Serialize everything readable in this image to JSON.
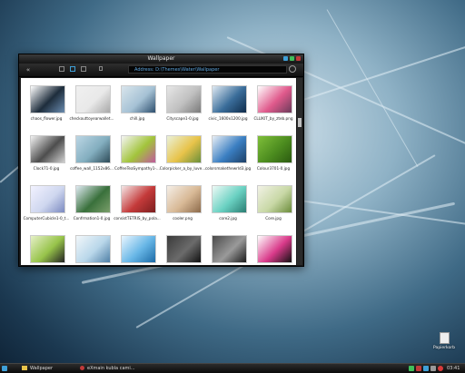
{
  "window": {
    "title": "Wallpaper",
    "address": "Address: D:\\Themes\\Water\\Wallpaper"
  },
  "toolbar": {
    "back_label": "«",
    "views": [
      "list",
      "icons",
      "details"
    ],
    "settings_icon": "gear-icon"
  },
  "files": [
    {
      "name": "chaos_flower.jpg",
      "colors": [
        "#ffffff",
        "#1e2d3c",
        "#6a8cb0"
      ]
    },
    {
      "name": "checkouttoyearwallet...",
      "colors": [
        "#f0f0f0",
        "#e9e9e9",
        "#a8a8a8"
      ]
    },
    {
      "name": "chill.jpg",
      "colors": [
        "#d9e5ec",
        "#a6c2d5",
        "#2e4f6e"
      ]
    },
    {
      "name": "Cityscape1-0.jpg",
      "colors": [
        "#e6e6e6",
        "#c0c0c0",
        "#7a7a7a"
      ]
    },
    {
      "name": "civic_1600x1200.jpg",
      "colors": [
        "#dfe9f2",
        "#3a6d9a",
        "#0e2b4a"
      ]
    },
    {
      "name": "CLLIKIT_by_zteb.png",
      "colors": [
        "#ffffff",
        "#e05a8c",
        "#6b3b5a"
      ]
    },
    {
      "name": "Clock71-0.jpg",
      "colors": [
        "#f2f2f2",
        "#4d4d4d",
        "#d0d0d0"
      ]
    },
    {
      "name": "coffee_wall_1152x86...",
      "colors": [
        "#bcd6e4",
        "#83aebf",
        "#2d4a57"
      ]
    },
    {
      "name": "CoffeeTeaSympathy1-...",
      "colors": [
        "#f5f5f5",
        "#a2c43b",
        "#c05a9c"
      ]
    },
    {
      "name": "Colorpicker_a_by_luve...",
      "colors": [
        "#eaf1d9",
        "#e8c34a",
        "#6a8f3a"
      ]
    },
    {
      "name": "colorsmakethewrld3.jpg",
      "colors": [
        "#e8eef5",
        "#3b7fc2",
        "#1d3f66"
      ]
    },
    {
      "name": "Colour3701-0.jpg",
      "colors": [
        "#7fbf3a",
        "#4c8c1f",
        "#2b5a10"
      ]
    },
    {
      "name": "ComputerCubicle1-0_t...",
      "colors": [
        "#f2f2ff",
        "#cfd7ef",
        "#7b8ac0"
      ]
    },
    {
      "name": "Confrmation1-0.jpg",
      "colors": [
        "#dfeaf2",
        "#39703b",
        "#7b9f6b"
      ]
    },
    {
      "name": "consistTETRIS_by_pola...",
      "colors": [
        "#f4e6e6",
        "#c43a3a",
        "#7b1e1e"
      ]
    },
    {
      "name": "cooler.png",
      "colors": [
        "#f5efe8",
        "#d8b996",
        "#8c6a4a"
      ]
    },
    {
      "name": "core2.jpg",
      "colors": [
        "#eefaf6",
        "#6ad1c2",
        "#2a7d72"
      ]
    },
    {
      "name": "Core.jpg",
      "colors": [
        "#f2f2e6",
        "#c8d8a6",
        "#6b8c3a"
      ]
    },
    {
      "name": "",
      "colors": [
        "#e6f0c8",
        "#97c34a",
        "#222222"
      ]
    },
    {
      "name": "",
      "colors": [
        "#f2f7fa",
        "#b9d7ea",
        "#4f7fa6"
      ]
    },
    {
      "name": "",
      "colors": [
        "#eaf6ff",
        "#67b6e6",
        "#1c6aa6"
      ]
    },
    {
      "name": "",
      "colors": [
        "#3a3a3a",
        "#6b6b6b",
        "#111111"
      ]
    },
    {
      "name": "",
      "colors": [
        "#4a4a4a",
        "#9a9a9a",
        "#1a1a1a"
      ]
    },
    {
      "name": "",
      "colors": [
        "#ffffff",
        "#d93a8a",
        "#111111"
      ]
    }
  ],
  "taskbar": {
    "start_label": "Wallpaper",
    "task_label": "eXmain kubla cami...",
    "clock": "03:41"
  },
  "desktop": {
    "icon_label": "Papierkorb"
  },
  "accent": "#5ea6df"
}
